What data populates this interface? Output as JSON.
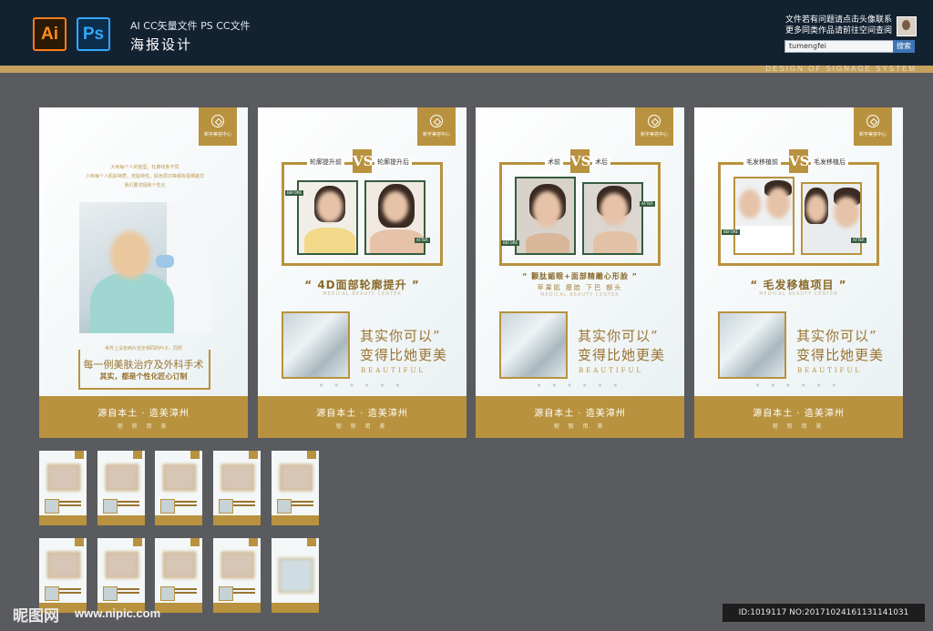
{
  "header": {
    "ai_icon": "Ai",
    "ps_icon": "Ps",
    "file_types": "AI CC矢量文件   PS CC文件",
    "title": "海报设计",
    "contact_line1": "文件若有问题请点击头像联系",
    "contact_line2": "更多同类作品请前往空间查阅",
    "search_value": "tumengfei",
    "search_button": "搜索",
    "subtitle_banner": "DESIGN OF SIGNAGE SYSTEM"
  },
  "posters": {
    "common": {
      "badge_text": "新宇美容中心",
      "slogan": "源自本土 · 造美漳州",
      "footer_sub": "韧 韧 用 美",
      "big_line1": "其实你可以”",
      "big_line2": "变得比她更美",
      "beautiful": "BEAUTIFUL",
      "center_en": "MEDICAL BEAUTY CENTER",
      "thin_line": "● ● ● ● ● ●",
      "before_tag": "BEFORE",
      "after_tag": "AFTER",
      "vs": "VS"
    },
    "p1": {
      "intro_line1": "大到每个人的脸型，轮廓线条不同",
      "intro_line2": "小到每个人肌肤特质，皮脂特性，肤色层次等都有极细差异",
      "intro_line3": "我们要求极致个性化",
      "small_note": "世界上没有两片完全相同的叶子，同样",
      "line1": "每一例美肤治疗及外科手术",
      "line2": "其实，都是个性化匠心订制"
    },
    "p2": {
      "before_label": "轮廓提升前",
      "after_label": "轮廓提升后",
      "project": "“ 4D面部轮廓提升 ”"
    },
    "p3": {
      "before_label": "术前",
      "after_label": "术后",
      "project": "“ 颧肽媚眼+面部精雕心形脸 ”",
      "treatments": "苹果肌   瘦脸   下巴   额头"
    },
    "p4": {
      "before_label": "毛发移植前",
      "after_label": "毛发移植后",
      "project": "“ 毛发移植项目 ”"
    }
  },
  "watermark": {
    "logo": "昵图网",
    "url": "www.nipic.com",
    "id_text": "ID:1019117 NO:20171024161131141031"
  },
  "colors": {
    "gold": "#b8923e",
    "navy": "#132231",
    "background": "#5a5b5e",
    "photo_tag_green": "#355c3f"
  }
}
